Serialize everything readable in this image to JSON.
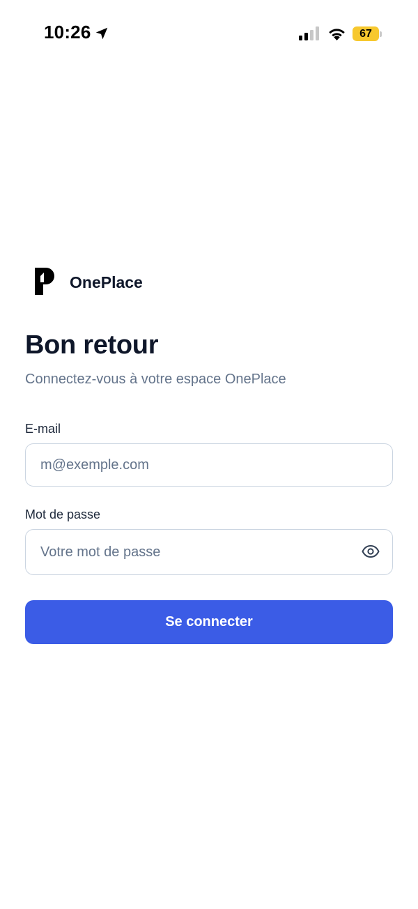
{
  "status_bar": {
    "time": "10:26",
    "battery_level": "67",
    "icons": [
      "location-arrow-icon",
      "cellular-signal-icon",
      "wifi-icon",
      "battery-icon"
    ],
    "battery_color": "#f7c82e"
  },
  "brand": {
    "name": "OnePlace",
    "logo_icon": "oneplace-logo-icon"
  },
  "login": {
    "title": "Bon retour",
    "subtitle": "Connectez-vous à votre espace OnePlace",
    "email_label": "E-mail",
    "email_placeholder": "m@exemple.com",
    "email_value": "",
    "password_label": "Mot de passe",
    "password_placeholder": "Votre mot de passe",
    "password_value": "",
    "password_toggle_icon": "eye-icon",
    "submit_label": "Se connecter"
  },
  "colors": {
    "accent": "#3b5ce6",
    "text_primary": "#0f172a",
    "text_muted": "#64748b",
    "border": "#cbd5e1"
  }
}
